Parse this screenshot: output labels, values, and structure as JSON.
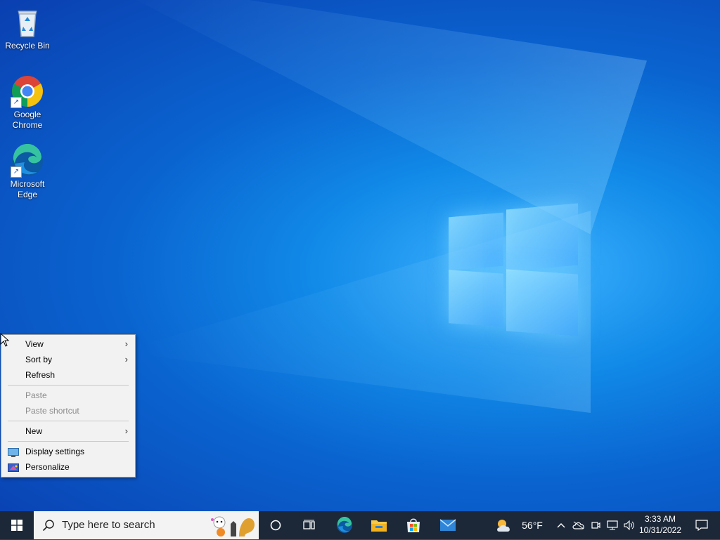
{
  "desktop": {
    "icons": [
      {
        "label": "Recycle Bin"
      },
      {
        "label": "Google Chrome"
      },
      {
        "label": "Microsoft Edge"
      }
    ]
  },
  "context_menu": {
    "items": [
      {
        "label": "View",
        "has_submenu": true,
        "enabled": true
      },
      {
        "label": "Sort by",
        "has_submenu": true,
        "enabled": true
      },
      {
        "label": "Refresh",
        "enabled": true
      },
      {
        "label": "Paste",
        "enabled": false
      },
      {
        "label": "Paste shortcut",
        "enabled": false
      },
      {
        "label": "New",
        "has_submenu": true,
        "enabled": true
      },
      {
        "label": "Display settings",
        "icon": "display-icon",
        "enabled": true
      },
      {
        "label": "Personalize",
        "icon": "personalize-icon",
        "enabled": true
      }
    ]
  },
  "taskbar": {
    "search_placeholder": "Type here to search",
    "pinned": [
      "cortana-icon",
      "task-view-icon",
      "edge-icon",
      "file-explorer-icon",
      "store-icon",
      "mail-icon"
    ],
    "weather": {
      "temp": "56°F",
      "icon": "partly-cloudy-icon"
    },
    "clock": {
      "time": "3:33 AM",
      "date": "10/31/2022"
    },
    "tray_icons": [
      "chevron-up-icon",
      "onedrive-icon",
      "meet-icon",
      "network-icon",
      "volume-icon",
      "notification-icon"
    ]
  },
  "colors": {
    "accent": "#0a64d0",
    "taskbar": "#1c2838"
  }
}
